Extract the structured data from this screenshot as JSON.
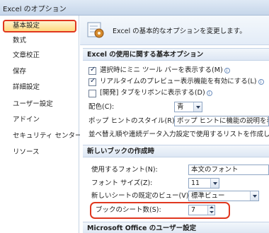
{
  "window": {
    "title": "Excel のオプション"
  },
  "sidebar": {
    "items": [
      {
        "label": "基本設定",
        "selected": true
      },
      {
        "label": "数式"
      },
      {
        "label": "文章校正"
      },
      {
        "label": "保存"
      },
      {
        "label": "詳細設定"
      },
      {
        "label": "ユーザー設定"
      },
      {
        "label": "アドイン"
      },
      {
        "label": "セキュリティ センター"
      },
      {
        "label": "リソース"
      }
    ]
  },
  "header": {
    "text": "Excel の基本的なオプションを変更します。"
  },
  "sections": {
    "basic": "Excel の使用に関する基本オプション",
    "new_book": "新しいブックの作成時",
    "user": "Microsoft Office のユーザー設定"
  },
  "basic_options": {
    "mini_toolbar": {
      "label": "選択時にミニ ツール バーを表示する(M)",
      "checked": true
    },
    "live_preview": {
      "label": "リアルタイムのプレビュー表示機能を有効にする(L)",
      "checked": true
    },
    "developer_tab": {
      "label": "[開発] タブをリボンに表示する(D)",
      "checked": false
    },
    "info_icon": "i",
    "color_scheme": {
      "label": "配色(C):",
      "value": "青"
    },
    "tooltip_style": {
      "label": "ポップ ヒントのスタイル(R):",
      "value": "ポップ ヒントに機能の説明を表示す"
    },
    "sort_text": "並べ替え順や連続データ入力設定で使用するリストを作成します"
  },
  "new_book_options": {
    "font": {
      "label": "使用するフォント(N):",
      "value": "本文のフォント"
    },
    "font_size": {
      "label": "フォント サイズ(Z):",
      "value": "11"
    },
    "default_view": {
      "label": "新しいシートの既定のビュー(V):",
      "value": "標準ビュー"
    },
    "sheet_count": {
      "label": "ブックのシート数(S):",
      "value": "7"
    }
  },
  "colors": {
    "highlight": "#e0371f",
    "selected_bg": "#ffd97f"
  }
}
